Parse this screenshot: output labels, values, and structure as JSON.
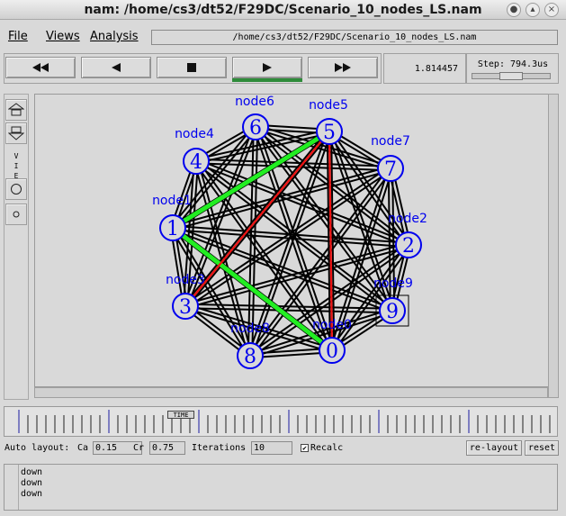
{
  "window": {
    "title": "nam: /home/cs3/dt52/F29DC/Scenario_10_nodes_LS.nam",
    "buttons": [
      "●",
      "▴",
      "×"
    ]
  },
  "menu": {
    "file": "File",
    "views": "Views",
    "analysis": "Analysis",
    "path": "/home/cs3/dt52/F29DC/Scenario_10_nodes_LS.nam"
  },
  "transport": {
    "buttons": [
      {
        "name": "rewind-button",
        "icon": "fast-rewind-icon"
      },
      {
        "name": "back-button",
        "icon": "play-backward-icon"
      },
      {
        "name": "stop-button",
        "icon": "stop-icon"
      },
      {
        "name": "play-button",
        "icon": "play-forward-icon",
        "active": true
      },
      {
        "name": "fast-forward-button",
        "icon": "fast-forward-icon"
      }
    ],
    "time": "1.814457",
    "step_label": "Step: 794.3us",
    "step_slider_fraction": 0.55
  },
  "tools": {
    "view_label": "V\nI\nE\nW"
  },
  "network": {
    "nodes": [
      {
        "id": "0",
        "label": "node0"
      },
      {
        "id": "1",
        "label": "node1"
      },
      {
        "id": "2",
        "label": "node2"
      },
      {
        "id": "3",
        "label": "node3"
      },
      {
        "id": "4",
        "label": "node4"
      },
      {
        "id": "5",
        "label": "node5"
      },
      {
        "id": "6",
        "label": "node6"
      },
      {
        "id": "7",
        "label": "node7"
      },
      {
        "id": "8",
        "label": "node8"
      },
      {
        "id": "9",
        "label": "node9"
      }
    ],
    "highlighted_links": [
      {
        "from": "1",
        "to": "5",
        "color": "#22ee22"
      },
      {
        "from": "1",
        "to": "0",
        "color": "#22ee22"
      },
      {
        "from": "3",
        "to": "5",
        "color": "#ee1111"
      },
      {
        "from": "5",
        "to": "0",
        "color": "#ee1111"
      }
    ],
    "node_color": "#0000ee",
    "link_color": "#000000"
  },
  "timeline": {
    "marker": "TIME"
  },
  "autolayout": {
    "label": "Auto layout:",
    "ca_label": "Ca",
    "ca_value": "0.15",
    "cr_label": "Cr",
    "cr_value": "0.75",
    "iterations_label": "Iterations",
    "iterations_value": "10",
    "recalc_label": "Recalc",
    "recalc_checked": true,
    "relayout_label": "re-layout",
    "reset_label": "reset"
  },
  "log": {
    "lines": [
      "down",
      "down",
      "down"
    ]
  }
}
